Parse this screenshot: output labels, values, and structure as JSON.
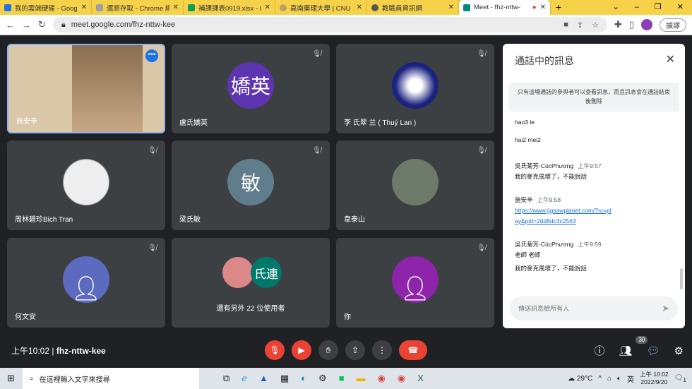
{
  "browser": {
    "tabs": [
      {
        "title": "我的雲端硬碟 - Google",
        "color": "#1a73e8"
      },
      {
        "title": "還原存取 - Chrome 網",
        "color": "#9aa0a6"
      },
      {
        "title": "補課課表0919.xlsx - G",
        "color": "#0f9d58"
      },
      {
        "title": "嘉南藥理大學 | CNU",
        "color": "#c0a060"
      },
      {
        "title": "教職員資訊網",
        "color": "#555555"
      },
      {
        "title": "Meet - fhz-nttw-",
        "color": "#00897b",
        "active": true
      }
    ],
    "url": "meet.google.com/fhz-nttw-kee",
    "profile_button": "擴譯"
  },
  "tiles": [
    {
      "name": "施安辛",
      "initials": "",
      "color": "#e8d8c0",
      "muted": false
    },
    {
      "name": "盧氏嬌英",
      "initials": "嬌英",
      "color": "#5e35b1",
      "muted": true
    },
    {
      "name": "李 氏翠 兰 ( Thuý Lan )",
      "initials": "",
      "color": "#1a237e",
      "muted": true
    },
    {
      "name": "周林碧珍Bich Tran",
      "initials": "",
      "color": "#eeeeee",
      "muted": true
    },
    {
      "name": "梁氏敏",
      "initials": "敏",
      "color": "#607d8b",
      "muted": true
    },
    {
      "name": "韋泰山",
      "initials": "",
      "color": "#6d7a6a",
      "muted": true
    },
    {
      "name": "何文安",
      "initials": "",
      "color": "#5c6bc0",
      "muted": true
    },
    {
      "name": "還有另外 22 位使用者",
      "initials": "氏連",
      "color": "#00796b",
      "muted": false
    },
    {
      "name": "你",
      "initials": "",
      "color": "#8e24aa",
      "muted": true
    }
  ],
  "chat": {
    "title": "通話中的訊息",
    "notice": "只有這場通話的參與者可以查看訊息，而且訊息會在通話結束後刪除",
    "messages": [
      {
        "text": "hao3 le"
      },
      {
        "text": "hai2 mei2"
      },
      {
        "sender": "吳氏菊芳-CúcPhương",
        "time": "上午9:57",
        "text": "我的麥克風壞了，不能說話"
      },
      {
        "sender": "施安辛",
        "time": "上午9:58",
        "link": "https://www.jigsawplanet.com/?rc=play&pid=2dd8dc3c2563"
      },
      {
        "sender": "吳氏菊芳-CúcPhương",
        "time": "上午9:59",
        "text": "老師 老師"
      },
      {
        "text": "我的麥克風壞了，不能說話"
      }
    ],
    "input_placeholder": "傳送訊息給所有人"
  },
  "bottom": {
    "time": "上午10:02",
    "meeting_code": "fhz-nttw-kee",
    "participants_count": "30"
  },
  "taskbar": {
    "search_placeholder": "在這裡輸入文字來搜尋",
    "weather": "29°C",
    "ime": "英",
    "time": "上午 10:02",
    "date": "2022/9/20",
    "notifications": "1"
  }
}
